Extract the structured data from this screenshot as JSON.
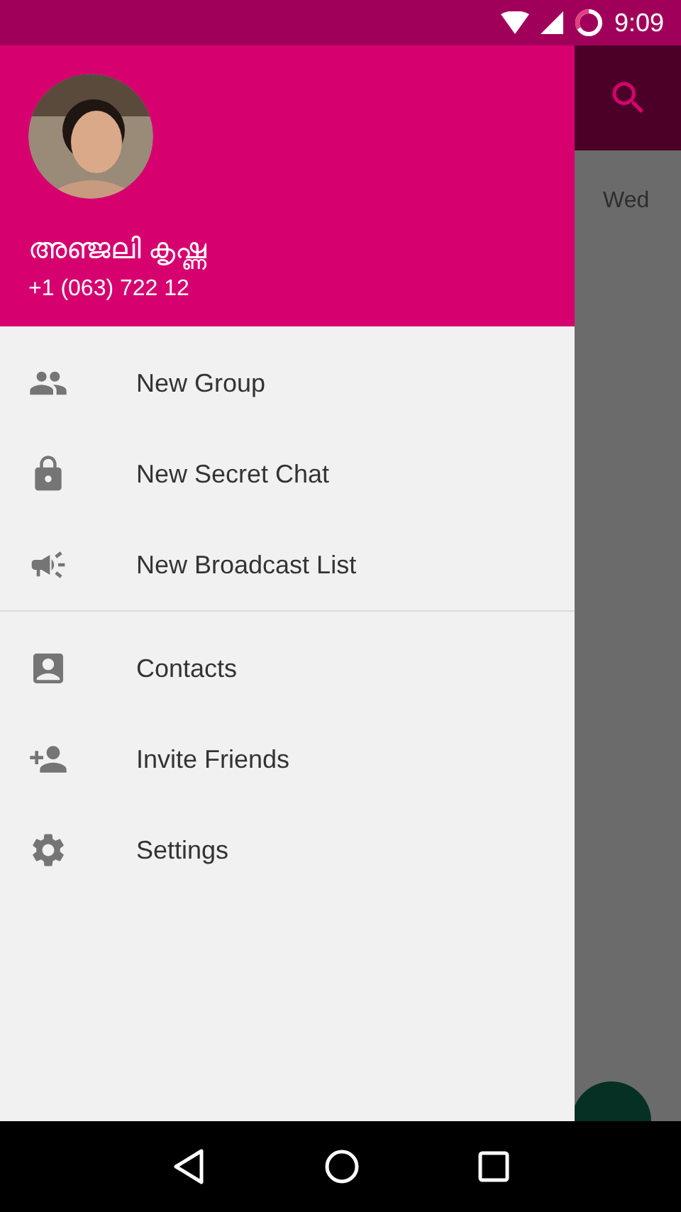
{
  "status_bar": {
    "time": "9:09"
  },
  "drawer": {
    "header": {
      "name": "അഞ്ജലി കൃഷ്ണ",
      "phone": "+1 (063) 722 12"
    },
    "sections": [
      {
        "items": [
          {
            "label": "New Group"
          },
          {
            "label": "New Secret Chat"
          },
          {
            "label": "New Broadcast List"
          }
        ]
      },
      {
        "items": [
          {
            "label": "Contacts"
          },
          {
            "label": "Invite Friends"
          },
          {
            "label": "Settings"
          }
        ]
      }
    ]
  },
  "background": {
    "chat_date": "Wed"
  }
}
